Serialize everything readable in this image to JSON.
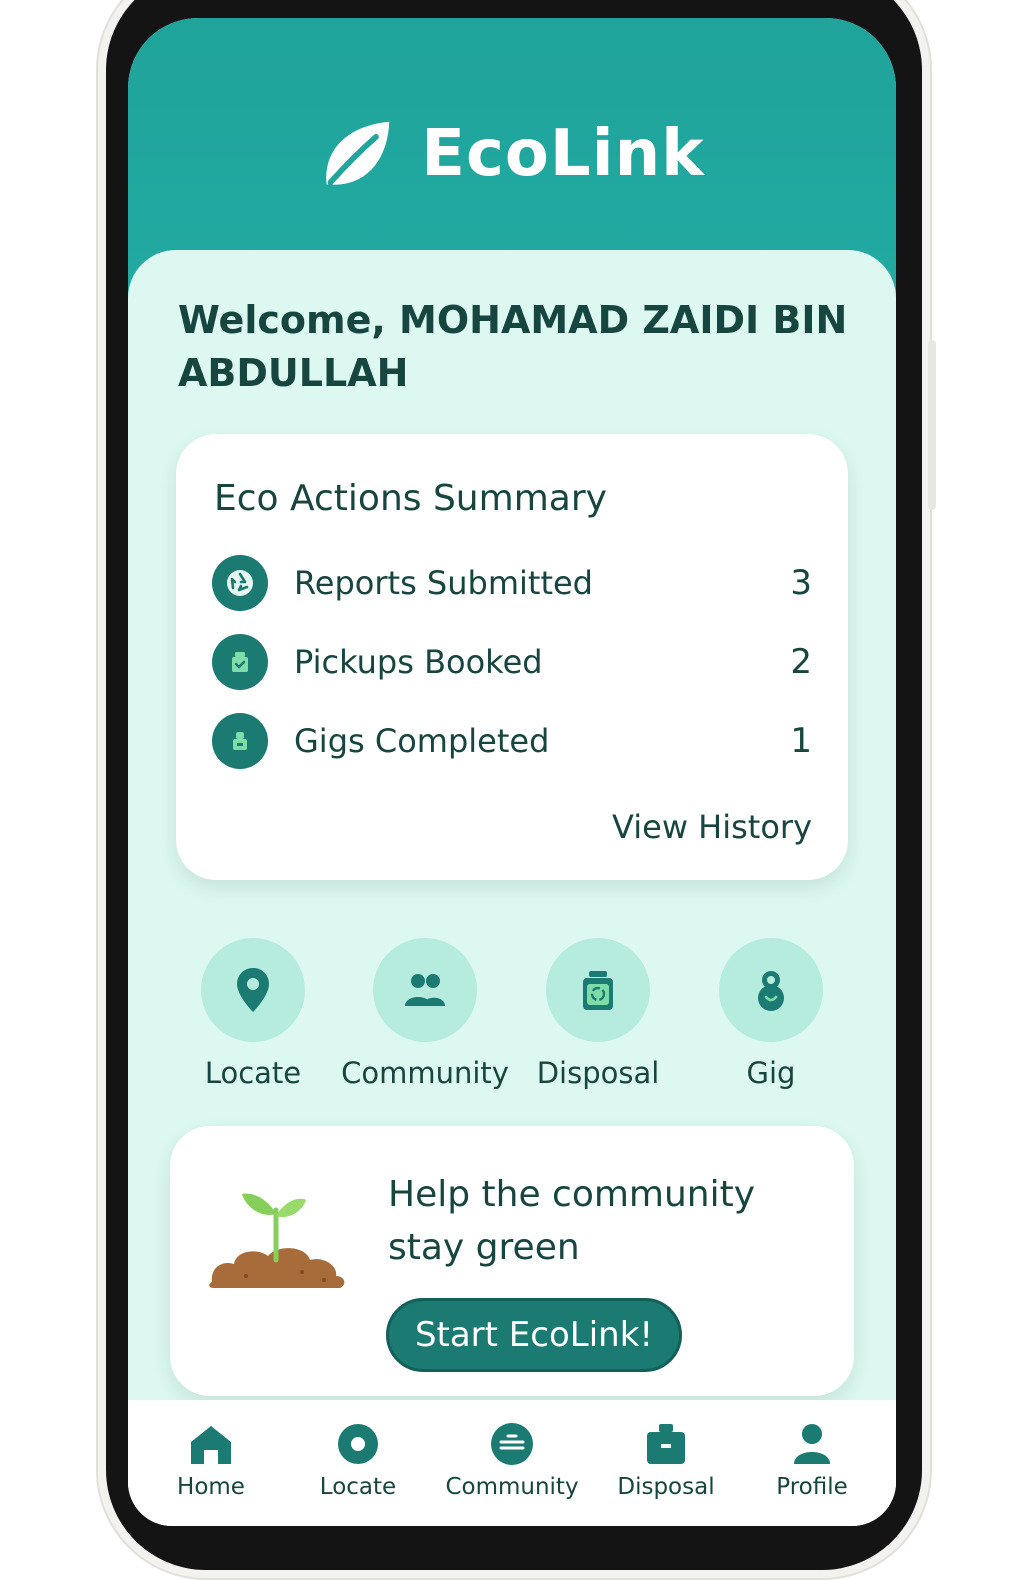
{
  "app": {
    "name": "EcoLink"
  },
  "welcome": {
    "text": "Welcome, MOHAMAD ZAIDI BIN ABDULLAH"
  },
  "summary": {
    "title": "Eco Actions Summary",
    "stats": [
      {
        "label": "Reports Submitted",
        "value": "3",
        "icon": "recycle-icon"
      },
      {
        "label": "Pickups Booked",
        "value": "2",
        "icon": "pickup-bin-icon"
      },
      {
        "label": "Gigs Completed",
        "value": "1",
        "icon": "gig-icon"
      }
    ],
    "view_history": "View History"
  },
  "quick_actions": [
    {
      "label": "Locate",
      "icon": "location-pin-icon"
    },
    {
      "label": "Community",
      "icon": "people-icon"
    },
    {
      "label": "Disposal",
      "icon": "recycle-bin-icon"
    },
    {
      "label": "Gig",
      "icon": "gig-person-icon"
    }
  ],
  "promo": {
    "text": "Help the community stay green",
    "cta": "Start EcoLink!",
    "image": "sprout-illustration"
  },
  "bottom_nav": [
    {
      "label": "Home",
      "icon": "home-icon"
    },
    {
      "label": "Locate",
      "icon": "locate-icon"
    },
    {
      "label": "Community",
      "icon": "community-icon"
    },
    {
      "label": "Disposal",
      "icon": "disposal-icon"
    },
    {
      "label": "Profile",
      "icon": "profile-icon"
    }
  ],
  "colors": {
    "header": "#22aba3",
    "background": "#dcf8f0",
    "accent": "#1b7a71",
    "text": "#17453f",
    "icon_circle": "#b6ecde"
  }
}
